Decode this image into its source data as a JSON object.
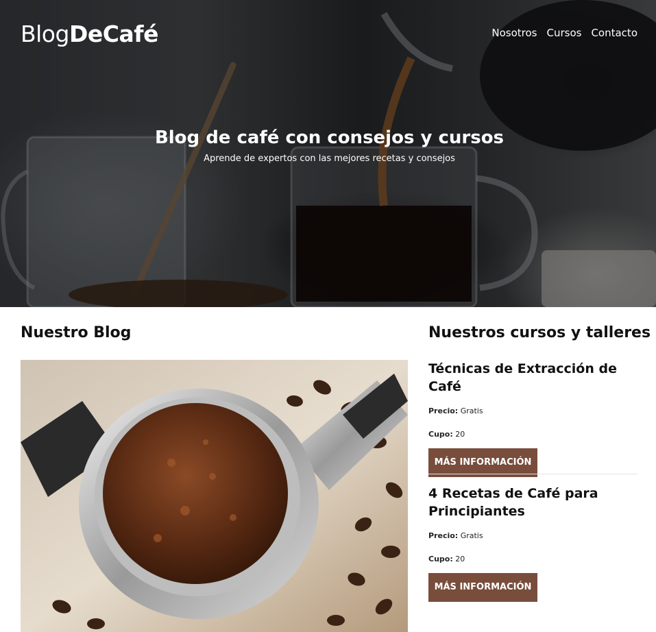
{
  "header": {
    "logo_light": "Blog",
    "logo_bold": "DeCafé",
    "nav": [
      "Nosotros",
      "Cursos",
      "Contacto"
    ]
  },
  "hero": {
    "title": "Blog de café con consejos y cursos",
    "subtitle": "Aprende de expertos con las mejores recetas y consejos"
  },
  "blog": {
    "heading": "Nuestro Blog"
  },
  "courses": {
    "heading": "Nuestros cursos y talleres",
    "items": [
      {
        "title": "Técnicas de Extracción de Café",
        "price_label": "Precio:",
        "price_value": "Gratis",
        "quota_label": "Cupo:",
        "quota_value": "20",
        "button": "Más Información"
      },
      {
        "title": "4 Recetas de Café para Principiantes",
        "price_label": "Precio:",
        "price_value": "Gratis",
        "quota_label": "Cupo:",
        "quota_value": "20",
        "button": "Más Información"
      }
    ]
  },
  "colors": {
    "accent": "#784d3c",
    "hero_overlay": "#000000",
    "text": "#111111"
  }
}
